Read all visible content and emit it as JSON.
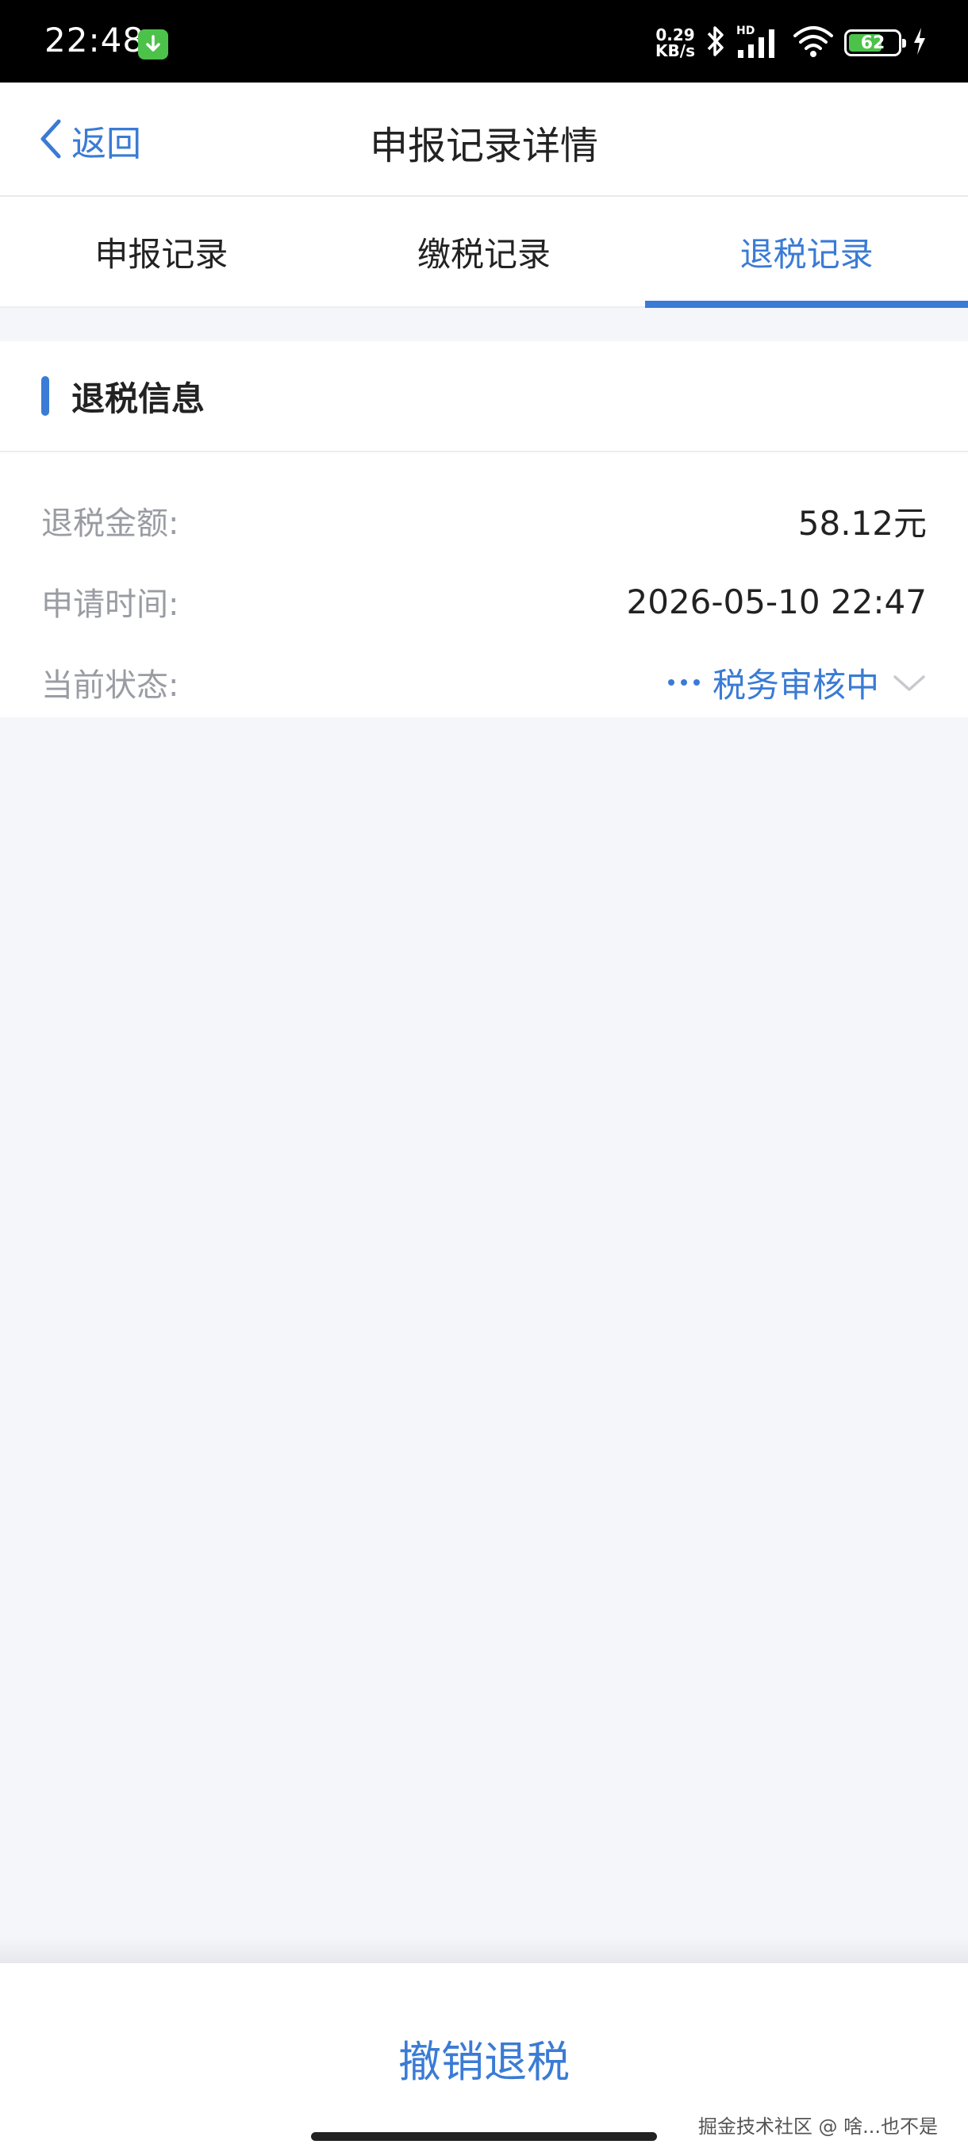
{
  "status_bar": {
    "time": "22:48",
    "net_speed_value": "0.29",
    "net_speed_unit": "KB/s",
    "hd_label": "HD",
    "battery_level": "62",
    "icons": [
      "download-icon",
      "bluetooth-icon",
      "signal-icon",
      "wifi-icon",
      "battery-icon",
      "charging-icon"
    ]
  },
  "nav": {
    "back_label": "返回",
    "title": "申报记录详情"
  },
  "tabs": [
    {
      "label": "申报记录",
      "active": false
    },
    {
      "label": "缴税记录",
      "active": false
    },
    {
      "label": "退税记录",
      "active": true
    }
  ],
  "section": {
    "title": "退税信息",
    "rows": [
      {
        "label": "退税金额:",
        "value": "58.12元"
      },
      {
        "label": "申请时间:",
        "value": "2026-05-10 22:47"
      },
      {
        "label": "当前状态:",
        "value": "税务审核中"
      }
    ]
  },
  "bottom": {
    "revoke_label": "撤销退税",
    "watermark": "掘金技术社区 @ 啥...也不是"
  },
  "colors": {
    "accent": "#3a7bd5",
    "background": "#f4f6fa",
    "battery_green": "#4cc24a"
  }
}
